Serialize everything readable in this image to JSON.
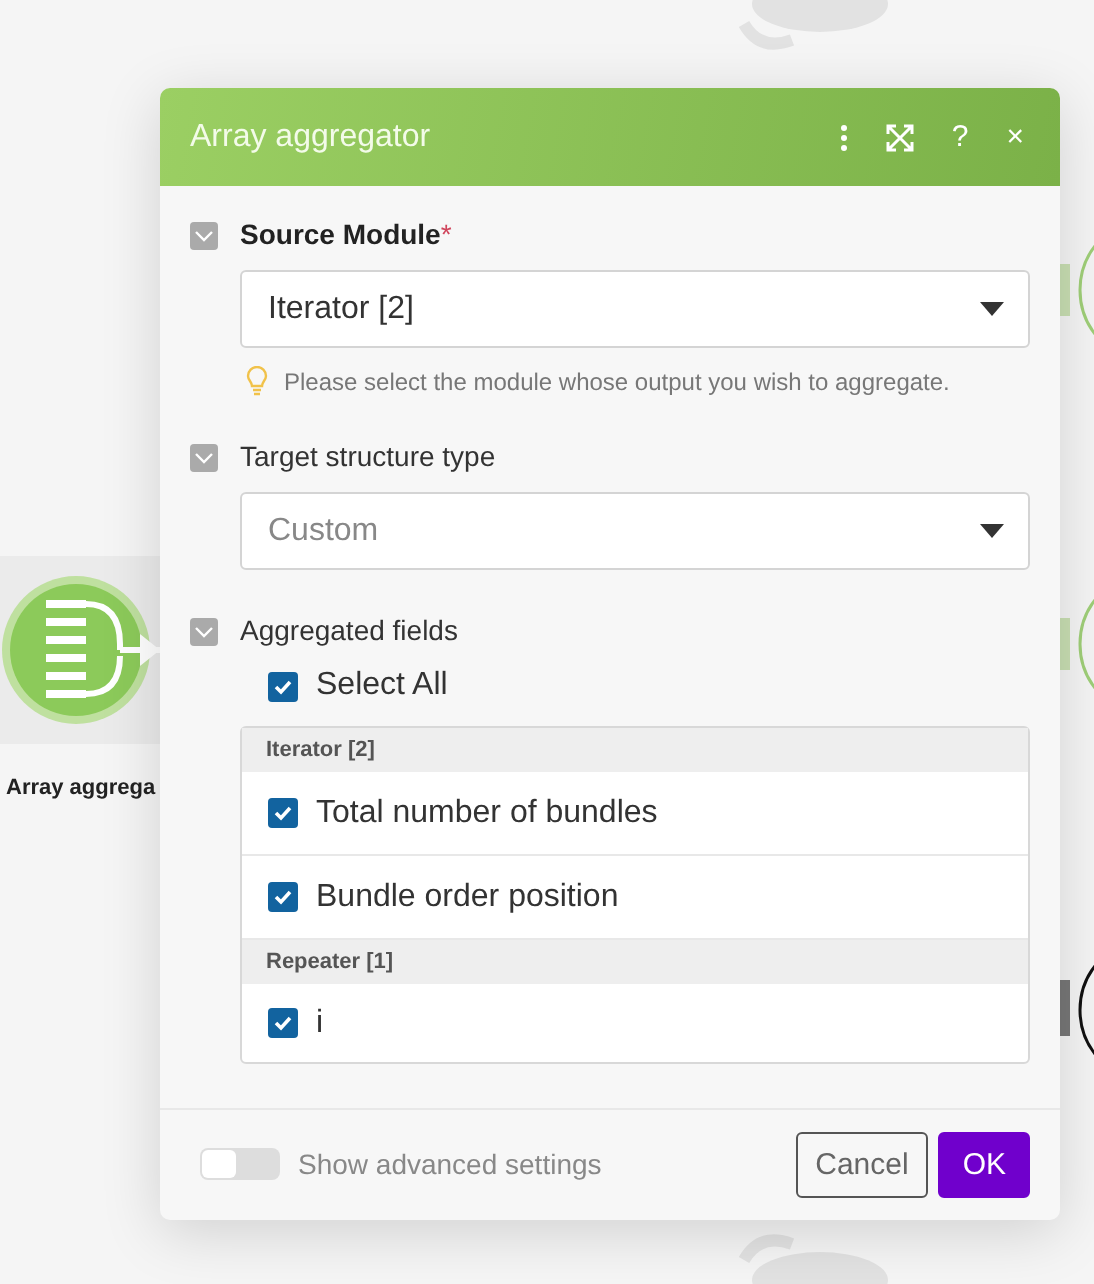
{
  "canvas": {
    "node_label": "Array aggrega"
  },
  "dialog": {
    "title": "Array aggregator",
    "actions": [
      {
        "kind": "menu"
      },
      {
        "kind": "expand"
      },
      {
        "kind": "glyph",
        "label": "?"
      },
      {
        "kind": "glyph",
        "label": "×"
      }
    ],
    "sections": [
      {
        "kind": "select",
        "label": "Source Module",
        "required_mark": "*",
        "expanded": true,
        "value": "Iterator [2]",
        "disabled": false,
        "hint": "Please select the module whose output you wish to aggregate."
      },
      {
        "kind": "select",
        "label": "Target structure type",
        "expanded": true,
        "value": "Custom",
        "disabled": true
      },
      {
        "kind": "fields",
        "label": "Aggregated fields",
        "expanded": true,
        "select_all": {
          "label": "Select All",
          "checked": true
        },
        "groups": [
          {
            "title": "Iterator [2]",
            "fields": [
              {
                "label": "Total number of bundles",
                "checked": true
              },
              {
                "label": "Bundle order position",
                "checked": true
              }
            ]
          },
          {
            "title": "Repeater [1]",
            "fields": [
              {
                "label": "i",
                "checked": true
              }
            ]
          }
        ]
      }
    ],
    "advanced": {
      "label": "Show advanced settings",
      "on": false
    },
    "buttons": [
      {
        "kind": "secondary",
        "label": "Cancel"
      },
      {
        "kind": "primary",
        "label": "OK"
      }
    ]
  }
}
